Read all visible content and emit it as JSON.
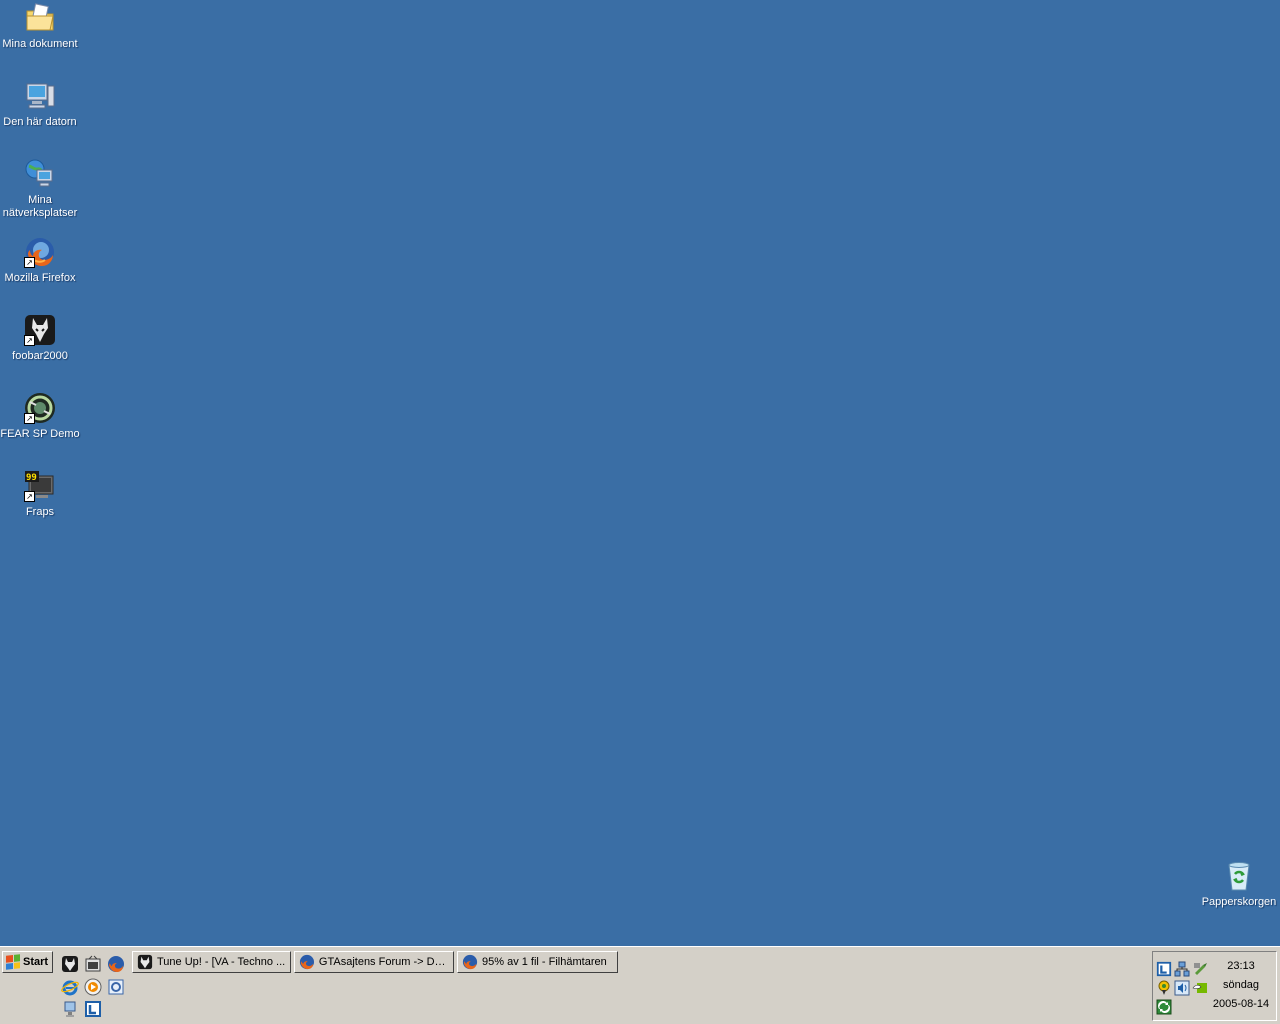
{
  "desktop": {
    "icons": [
      {
        "label": "Mina dokument",
        "icon": "folder-documents-icon"
      },
      {
        "label": "Den här datorn",
        "icon": "my-computer-icon"
      },
      {
        "label": "Mina nätverksplatser",
        "icon": "network-places-icon"
      },
      {
        "label": "Mozilla Firefox",
        "icon": "firefox-icon"
      },
      {
        "label": "foobar2000",
        "icon": "foobar2000-icon"
      },
      {
        "label": "FEAR SP Demo",
        "icon": "fear-icon"
      },
      {
        "label": "Fraps",
        "icon": "fraps-icon"
      }
    ],
    "recycle_bin": {
      "label": "Papperskorgen",
      "icon": "recycle-bin-icon"
    }
  },
  "taskbar": {
    "start_label": "Start",
    "tasks": [
      {
        "label": "Tune Up! - [VA - Techno ...",
        "icon": "foobar2000-icon"
      },
      {
        "label": "GTAsajtens Forum -> Du...",
        "icon": "firefox-icon"
      },
      {
        "label": "95% av 1 fil - Filhämtaren",
        "icon": "firefox-icon"
      }
    ],
    "tray": {
      "time": "23:13",
      "day": "söndag",
      "date": "2005-08-14"
    }
  },
  "colors": {
    "desktop_bg": "#3a6ea5",
    "taskbar_bg": "#d4d0c8"
  }
}
